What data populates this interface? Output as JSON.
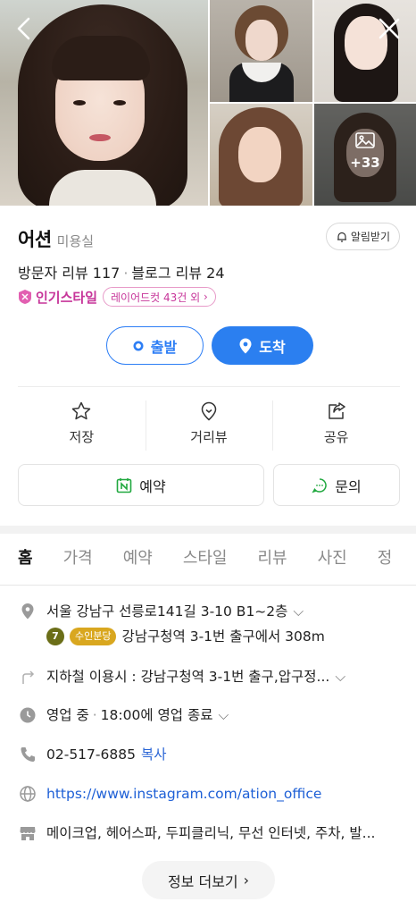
{
  "gallery": {
    "more_count": "+33"
  },
  "place": {
    "name": "어션",
    "category": "미용실",
    "alarm_label": "알림받기",
    "visitor_reviews": "방문자 리뷰 117",
    "blog_reviews": "블로그 리뷰 24",
    "popular_label": "인기스타일",
    "popular_chip": "레이어드컷 43건 외"
  },
  "directions": {
    "depart_label": "출발",
    "arrive_label": "도착"
  },
  "actions": [
    {
      "label": "저장",
      "icon": "star-icon"
    },
    {
      "label": "거리뷰",
      "icon": "map-pin-outline-icon"
    },
    {
      "label": "공유",
      "icon": "share-icon"
    }
  ],
  "booking": {
    "reserve_label": "예약",
    "inquiry_label": "문의"
  },
  "tabs": [
    "홈",
    "가격",
    "예약",
    "스타일",
    "리뷰",
    "사진",
    "정"
  ],
  "details": {
    "address": "서울 강남구 선릉로141길 3-10 B1~2층",
    "subway_line": "7",
    "subway_line_name": "수인분당",
    "subway_exit": "강남구청역 3-1번 출구에서 308m",
    "transit": "지하철 이용시 : 강남구청역 3-1번 출구,압구정...",
    "hours_status": "영업 중",
    "hours_end": "18:00에 영업 종료",
    "phone": "02-517-6885",
    "copy_label": "복사",
    "website": "https://www.instagram.com/ation_office",
    "amenities": "메이크업, 헤어스파, 두피클리닉, 무선 인터넷, 주차, 발..."
  },
  "more_info_label": "정보 더보기",
  "colors": {
    "primary_blue": "#2b7ff0",
    "popular_pink": "#c7369a",
    "subway_line7": "#6b6e18",
    "subway_suin": "#d9a71f"
  }
}
